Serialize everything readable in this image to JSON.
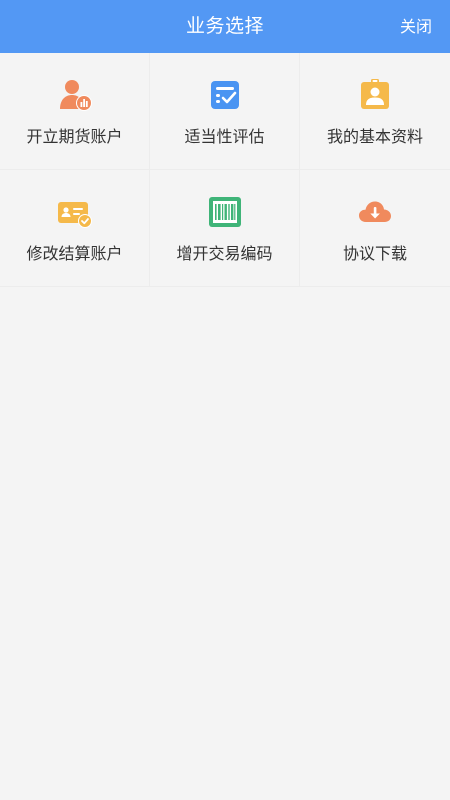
{
  "header": {
    "title": "业务选择",
    "close_label": "关闭"
  },
  "colors": {
    "header_bg": "#5398f4",
    "page_bg": "#f4f4f4",
    "orange": "#f08a5d",
    "blue": "#4a94f2",
    "yellow": "#f5b94a",
    "green": "#3fb478"
  },
  "services": [
    {
      "label": "开立期货账户",
      "icon": "user-chart-icon"
    },
    {
      "label": "适当性评估",
      "icon": "checklist-icon"
    },
    {
      "label": "我的基本资料",
      "icon": "id-badge-icon"
    },
    {
      "label": "修改结算账户",
      "icon": "card-check-icon"
    },
    {
      "label": "增开交易编码",
      "icon": "barcode-icon"
    },
    {
      "label": "协议下载",
      "icon": "cloud-download-icon"
    }
  ]
}
